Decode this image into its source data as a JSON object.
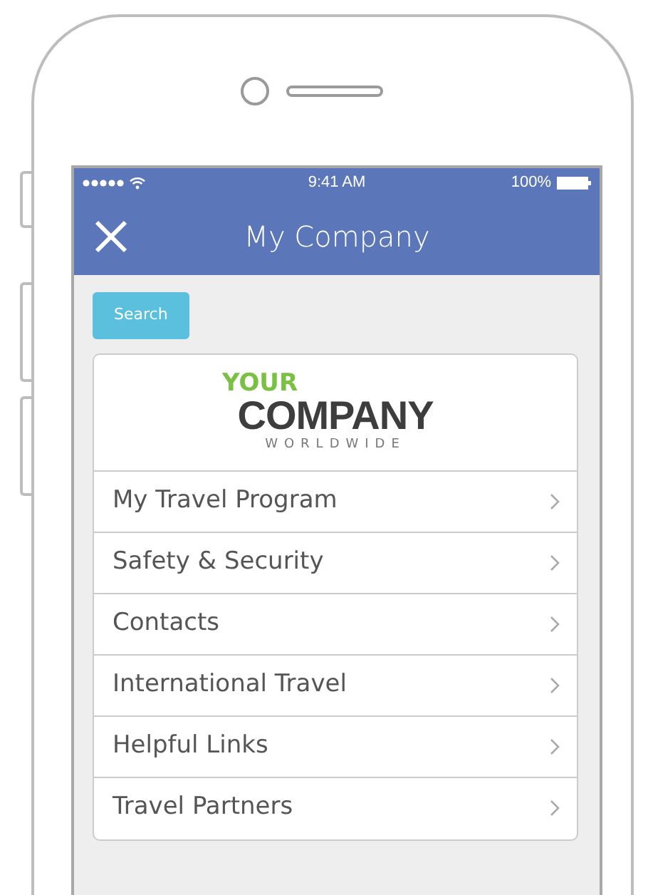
{
  "status_bar": {
    "time": "9:41 AM",
    "battery": "100%"
  },
  "nav_bar": {
    "title": "My Company"
  },
  "search_button": "Search",
  "logo": {
    "line_1": "YOUR",
    "line_2": "COMPANY",
    "line_3": "WORLDWIDE"
  },
  "menu": [
    {
      "label": "My Travel Program"
    },
    {
      "label": "Safety & Security"
    },
    {
      "label": "Contacts"
    },
    {
      "label": "International Travel"
    },
    {
      "label": "Helpful Links"
    },
    {
      "label": "Travel Partners"
    }
  ]
}
